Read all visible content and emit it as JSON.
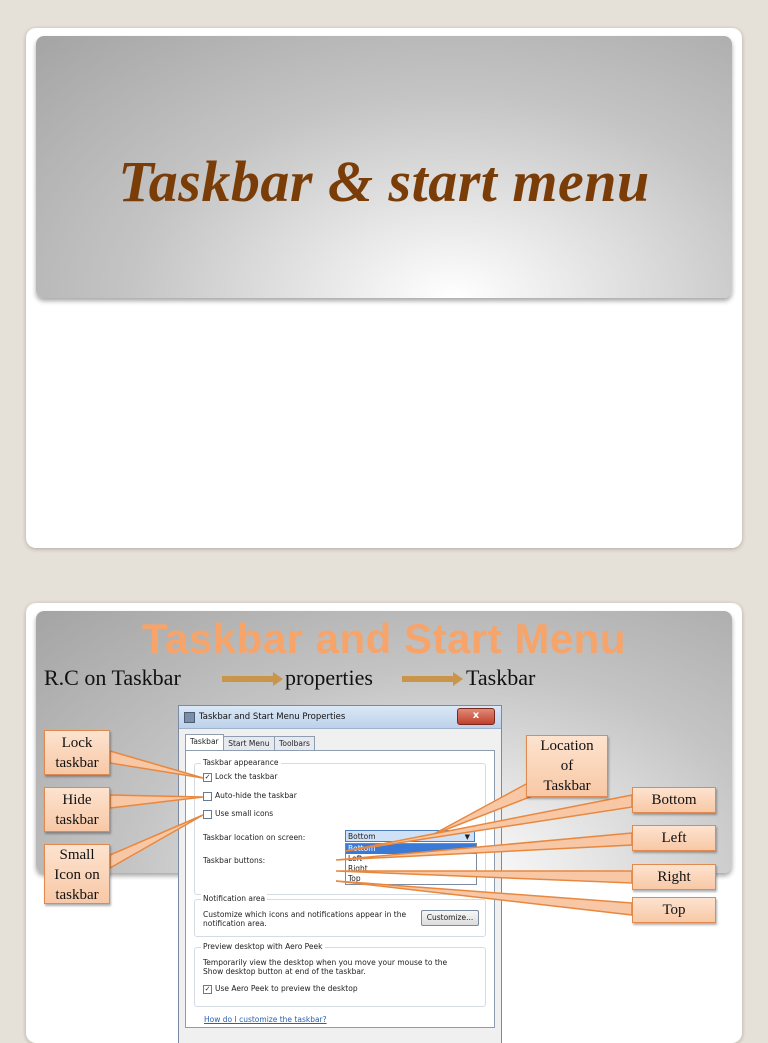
{
  "slide1": {
    "title": "Taskbar & start menu"
  },
  "slide2": {
    "title": "Taskbar and Start Menu",
    "path": {
      "step1": "R.C on Taskbar",
      "step2": "properties",
      "step3": "Taskbar"
    },
    "dialog": {
      "title": "Taskbar and Start Menu Properties",
      "close_label": "x",
      "tabs": [
        "Taskbar",
        "Start Menu",
        "Toolbars"
      ],
      "appearance_group": "Taskbar appearance",
      "lock_label": "Lock the taskbar",
      "lock_checked": true,
      "autohide_label": "Auto-hide the taskbar",
      "autohide_checked": false,
      "small_icons_label": "Use small icons",
      "small_icons_checked": false,
      "location_label": "Taskbar location on screen:",
      "location_value": "Bottom",
      "location_options": [
        "Bottom",
        "Left",
        "Right",
        "Top"
      ],
      "buttons_label": "Taskbar buttons:",
      "notification_group": "Notification area",
      "notification_text_1": "Customize which icons and notifications appear in the",
      "notification_text_2": "notification area.",
      "customize_button": "Customize...",
      "peek_group": "Preview desktop with Aero Peek",
      "peek_text_1": "Temporarily view the desktop when you move your mouse to the",
      "peek_text_2": "Show desktop button at end of the taskbar.",
      "peek_label": "Use Aero Peek to preview the desktop",
      "peek_checked": true,
      "help_link": "How do I customize the taskbar?"
    },
    "callouts": {
      "lock": [
        "Lock",
        "taskbar"
      ],
      "hide": [
        "Hide",
        "taskbar"
      ],
      "small": [
        "Small",
        "Icon on",
        "taskbar"
      ],
      "location": [
        "Location",
        "of",
        "Taskbar"
      ],
      "bottom": "Bottom",
      "left": "Left",
      "right": "Right",
      "top": "Top"
    }
  },
  "colors": {
    "title1": "#7a3d08",
    "title2": "#f7a46a",
    "callout_fill": "#f8c8a6",
    "callout_border": "#e08a50",
    "arrow": "#c8954a"
  }
}
